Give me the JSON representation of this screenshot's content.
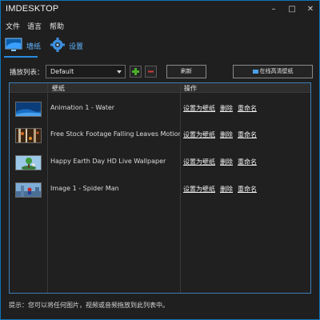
{
  "app": {
    "title": "IMDESKTOP",
    "window_buttons": [
      "–",
      "□",
      "✕"
    ]
  },
  "menu": [
    "文件",
    "语言",
    "帮助"
  ],
  "tabs": [
    {
      "label": "墙纸",
      "icon": "wallpaper-icon",
      "active": true
    },
    {
      "label": "设置",
      "icon": "gear-icon",
      "active": false
    }
  ],
  "playlist": {
    "label": "播放列表：",
    "selected": "Default",
    "add_button": "+",
    "remove_button": "−"
  },
  "toolbar": {
    "refresh_label": "刷新",
    "online_label": "在线高清壁纸"
  },
  "table": {
    "headers": {
      "wallpaper": "壁纸",
      "actions": "操作"
    },
    "rows": [
      {
        "name": "Animation 1 - Water",
        "thumb": "water"
      },
      {
        "name": "Free Stock Footage Falling Leaves Motion Backg",
        "thumb": "leaves"
      },
      {
        "name": "Happy Earth Day HD Live Wallpaper",
        "thumb": "earth"
      },
      {
        "name": "Image 1 - Spider Man",
        "thumb": "spider"
      }
    ],
    "actions": {
      "set": "设置为壁纸",
      "delete": "删除",
      "rename": "重命名"
    }
  },
  "hint": "提示：您可以将任何图片，视频或音频拖放到此列表中。",
  "colors": {
    "accent": "#2a8be0",
    "border": "#0f72b8",
    "add": "#4caf2a",
    "remove": "#d23a3a"
  }
}
